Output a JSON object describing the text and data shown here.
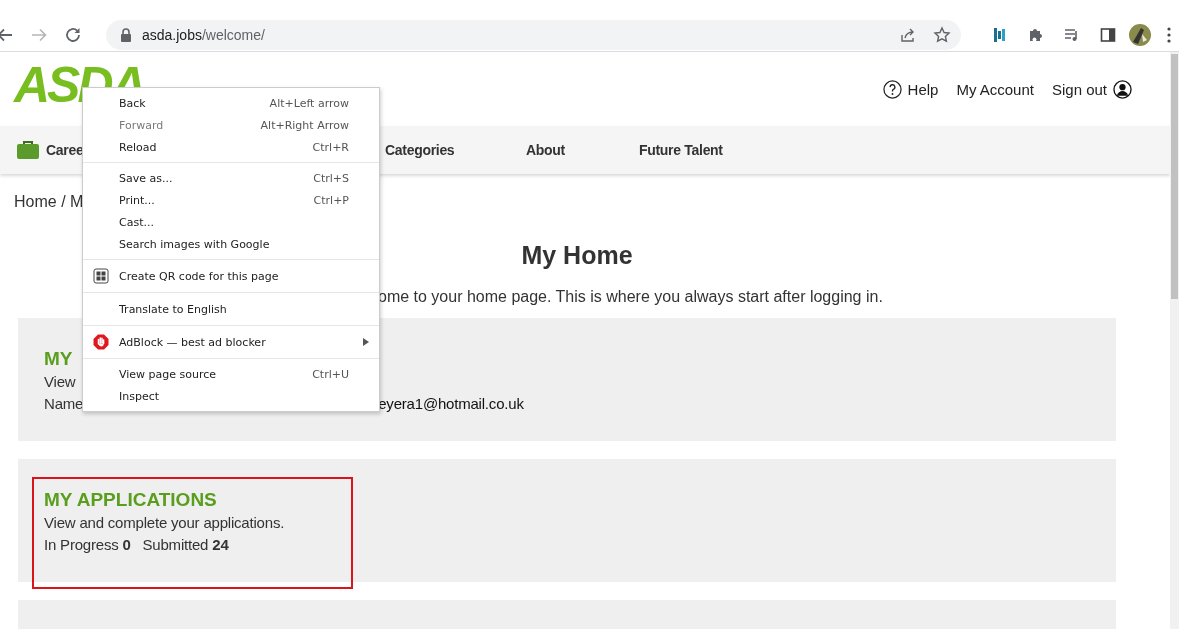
{
  "browser": {
    "back_enabled": true,
    "forward_enabled": false,
    "url_host": "asda.jobs",
    "url_path": "/welcome/"
  },
  "site": {
    "logo": "ASDA",
    "top_links": [
      {
        "label": "Help"
      },
      {
        "label": "My Account"
      },
      {
        "label": "Sign out"
      }
    ],
    "nav": [
      {
        "label": "Caree"
      },
      {
        "label": "Categories"
      },
      {
        "label": "About"
      },
      {
        "label": "Future Talent"
      }
    ]
  },
  "breadcrumb": "Home / M",
  "title": "My Home",
  "intro": "ome to your home page. This is where you always start after logging in.",
  "cards": [
    {
      "heading": "MY",
      "lines": [
        {
          "parts": [
            "View"
          ]
        },
        {
          "parts": [
            "Name",
            "eyera1@hotmail.co.uk"
          ]
        }
      ],
      "highlighted": false
    },
    {
      "heading": "MY APPLICATIONS",
      "lines": [
        {
          "parts": [
            "View and complete your applications."
          ]
        },
        {
          "parts": [
            "In Progress **0**   Submitted **24**"
          ]
        }
      ],
      "highlighted": true
    },
    {
      "highlighted": false
    }
  ],
  "context_menu": {
    "groups": [
      [
        {
          "label": "Back",
          "shortcut": "Alt+Left arrow",
          "disabled": false
        },
        {
          "label": "Forward",
          "shortcut": "Alt+Right Arrow",
          "disabled": true
        },
        {
          "label": "Reload",
          "shortcut": "Ctrl+R",
          "disabled": false
        }
      ],
      [
        {
          "label": "Save as...",
          "shortcut": "Ctrl+S",
          "disabled": false
        },
        {
          "label": "Print...",
          "shortcut": "Ctrl+P",
          "disabled": false
        },
        {
          "label": "Cast...",
          "disabled": false
        },
        {
          "label": "Search images with Google",
          "disabled": false
        }
      ],
      [
        {
          "label": "Create QR code for this page",
          "disabled": false
        }
      ],
      [
        {
          "label": "Translate to English",
          "disabled": false
        }
      ],
      [
        {
          "label": "AdBlock — best ad blocker",
          "submenu": true,
          "disabled": false
        }
      ],
      [
        {
          "label": "View page source",
          "shortcut": "Ctrl+U",
          "disabled": false
        },
        {
          "label": "Inspect",
          "disabled": false
        }
      ]
    ]
  }
}
